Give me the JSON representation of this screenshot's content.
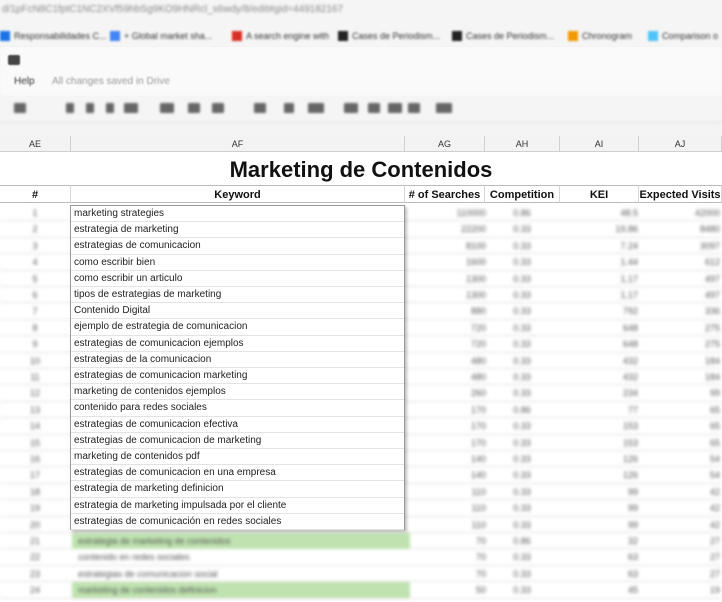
{
  "browser": {
    "url": "d/1pFcN8C1fptC1NC2XVf59hbSg9KO9HNRcl_s6wdy/8/edit#gid=449182167",
    "bookmarks": [
      {
        "label": "Responsabilidades C...",
        "color": "#1a73e8"
      },
      {
        "label": "+ Global market sha...",
        "color": "#4285f4"
      },
      {
        "label": "A search engine with",
        "color": "#d93025"
      },
      {
        "label": "Cases de Periodism...",
        "color": "#222222"
      },
      {
        "label": "Cases de Periodism...",
        "color": "#222222"
      },
      {
        "label": "Chronogram",
        "color": "#f29900"
      },
      {
        "label": "Comparison o",
        "color": "#4fc3f7"
      }
    ]
  },
  "docbar": {
    "menu_help": "Help",
    "saved_status": "All changes saved in Drive"
  },
  "column_headers": [
    "AE",
    "AF",
    "AG",
    "AH",
    "AI",
    "AJ"
  ],
  "sheet": {
    "title": "Marketing de Contenidos",
    "headers": [
      "#",
      "Keyword",
      "# of Searches",
      "Competition",
      "KEI",
      "Expected Visits"
    ],
    "rows": [
      {
        "n": "1",
        "kw": "",
        "searches": "110000",
        "comp": "0.86",
        "kei": "48.5",
        "visits": "42000",
        "green": false
      },
      {
        "n": "2",
        "kw": "",
        "searches": "22200",
        "comp": "0.33",
        "kei": "19.86",
        "visits": "8480",
        "green": false
      },
      {
        "n": "3",
        "kw": "",
        "searches": "8100",
        "comp": "0.33",
        "kei": "7.24",
        "visits": "3097",
        "green": false
      },
      {
        "n": "4",
        "kw": "",
        "searches": "1600",
        "comp": "0.33",
        "kei": "1.44",
        "visits": "612",
        "green": false
      },
      {
        "n": "5",
        "kw": "",
        "searches": "1300",
        "comp": "0.33",
        "kei": "1.17",
        "visits": "497",
        "green": false
      },
      {
        "n": "6",
        "kw": "",
        "searches": "1300",
        "comp": "0.33",
        "kei": "1.17",
        "visits": "497",
        "green": false
      },
      {
        "n": "7",
        "kw": "",
        "searches": "880",
        "comp": "0.33",
        "kei": "792",
        "visits": "336",
        "green": false
      },
      {
        "n": "8",
        "kw": "",
        "searches": "720",
        "comp": "0.33",
        "kei": "648",
        "visits": "275",
        "green": false
      },
      {
        "n": "9",
        "kw": "",
        "searches": "720",
        "comp": "0.33",
        "kei": "648",
        "visits": "275",
        "green": false
      },
      {
        "n": "10",
        "kw": "",
        "searches": "480",
        "comp": "0.33",
        "kei": "432",
        "visits": "184",
        "green": false
      },
      {
        "n": "11",
        "kw": "",
        "searches": "480",
        "comp": "0.33",
        "kei": "432",
        "visits": "184",
        "green": false
      },
      {
        "n": "12",
        "kw": "",
        "searches": "260",
        "comp": "0.33",
        "kei": "234",
        "visits": "99",
        "green": false
      },
      {
        "n": "13",
        "kw": "",
        "searches": "170",
        "comp": "0.86",
        "kei": "77",
        "visits": "65",
        "green": false
      },
      {
        "n": "14",
        "kw": "",
        "searches": "170",
        "comp": "0.33",
        "kei": "153",
        "visits": "65",
        "green": false
      },
      {
        "n": "15",
        "kw": "",
        "searches": "170",
        "comp": "0.33",
        "kei": "153",
        "visits": "65",
        "green": false
      },
      {
        "n": "16",
        "kw": "",
        "searches": "140",
        "comp": "0.33",
        "kei": "126",
        "visits": "54",
        "green": false
      },
      {
        "n": "17",
        "kw": "",
        "searches": "140",
        "comp": "0.33",
        "kei": "126",
        "visits": "54",
        "green": false
      },
      {
        "n": "18",
        "kw": "",
        "searches": "110",
        "comp": "0.33",
        "kei": "99",
        "visits": "42",
        "green": false
      },
      {
        "n": "19",
        "kw": "",
        "searches": "110",
        "comp": "0.33",
        "kei": "99",
        "visits": "42",
        "green": false
      },
      {
        "n": "20",
        "kw": "",
        "searches": "110",
        "comp": "0.33",
        "kei": "99",
        "visits": "42",
        "green": false
      },
      {
        "n": "21",
        "kw": "estrategia de marketing de contenidos",
        "searches": "70",
        "comp": "0.86",
        "kei": "32",
        "visits": "27",
        "green": true
      },
      {
        "n": "22",
        "kw": "contenido en redes sociales",
        "searches": "70",
        "comp": "0.33",
        "kei": "63",
        "visits": "27",
        "green": false
      },
      {
        "n": "23",
        "kw": "estrategias de comunicacion social",
        "searches": "70",
        "comp": "0.33",
        "kei": "63",
        "visits": "27",
        "green": false
      },
      {
        "n": "24",
        "kw": "marketing de contenidos definicion",
        "searches": "50",
        "comp": "0.33",
        "kei": "45",
        "visits": "19",
        "green": true
      }
    ]
  },
  "dropdown": {
    "items": [
      "marketing strategies",
      "estrategia de marketing",
      "estrategias de comunicacion",
      "como escribir bien",
      "como escribir un articulo",
      "tipos de estrategias de marketing",
      "Contenido Digital",
      "ejemplo de estrategia de comunicacion",
      "estrategias de comunicacion ejemplos",
      "estrategias de la comunicacion",
      "estrategias de comunicacion marketing",
      "marketing de contenidos ejemplos",
      "contenido para redes sociales",
      "estrategias de comunicacion efectiva",
      "estrategias de comunicacion de marketing",
      "marketing de contenidos pdf",
      "estrategias de comunicacion en una empresa",
      "estrategia de marketing definicion",
      "estrategia de marketing impulsada por el cliente",
      "estrategias de comunicación en redes sociales"
    ]
  }
}
